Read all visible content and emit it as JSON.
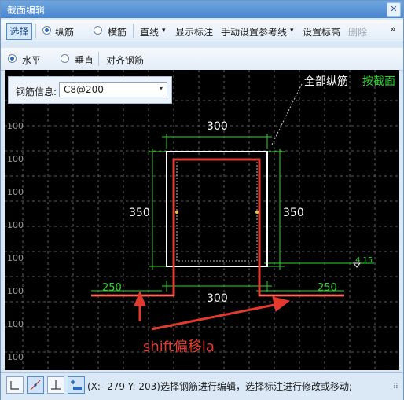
{
  "window": {
    "title": "截面编辑",
    "close_label": "✕"
  },
  "toolbar1": {
    "select": "选择",
    "longitudinal": "纵筋",
    "transverse": "横筋",
    "line": "直线",
    "show_dim": "显示标注",
    "manual_ref": "手动设置参考线",
    "set_elev": "设置标高",
    "delete": "删除",
    "more": "»",
    "dropdown_arrow": "▾"
  },
  "toolbar2": {
    "horizontal": "水平",
    "vertical": "垂直",
    "align": "对齐钢筋"
  },
  "rebar_info": {
    "label": "钢筋信息:",
    "value": "C8@200"
  },
  "canvas": {
    "left_ticks": [
      "100",
      "100",
      "100",
      "100",
      "100",
      "100",
      "100",
      "100",
      "100",
      "100"
    ],
    "dims": {
      "top": "300",
      "left": "350",
      "right": "350",
      "bottom": "300",
      "left_ext": "250",
      "right_ext": "250",
      "elev": "4.15"
    },
    "label_all": "全部纵筋",
    "label_section": "按截面",
    "annotation": "shift偏移la"
  },
  "status": {
    "text": "(X: -279 Y: 203)选择钢筋进行编辑，选择标注进行修改或移动;"
  },
  "colors": {
    "white": "#ffffff",
    "green": "#2fd62f",
    "red": "#e23a2e",
    "grid": "#5e5e5e"
  }
}
